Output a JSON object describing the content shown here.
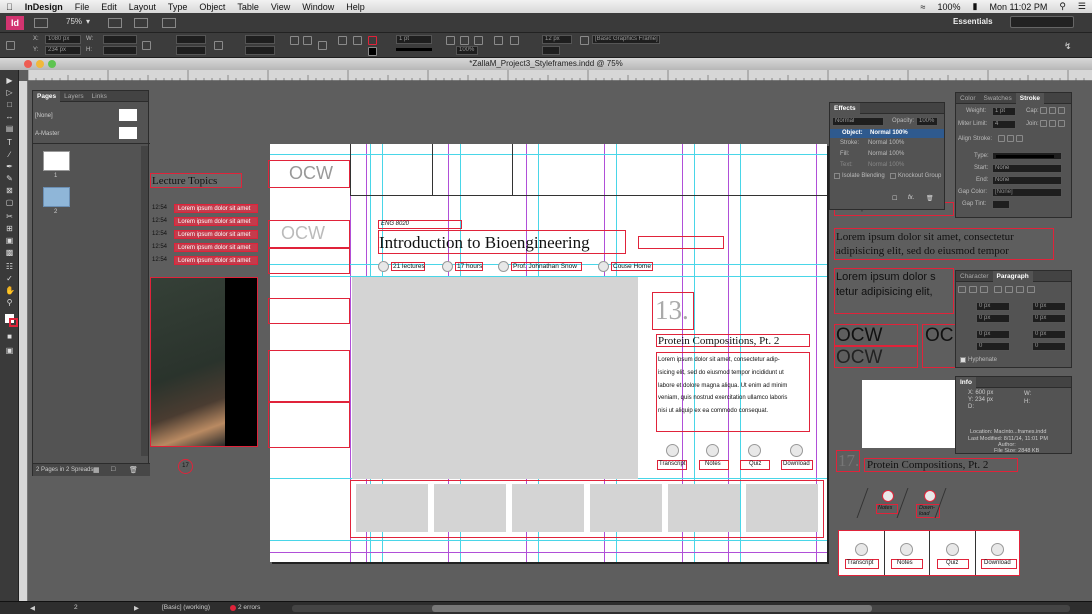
{
  "menubar": {
    "app": "InDesign",
    "items": [
      "File",
      "Edit",
      "Layout",
      "Type",
      "Object",
      "Table",
      "View",
      "Window",
      "Help"
    ],
    "battery": "100%",
    "clock": "Mon 11:02 PM"
  },
  "appbar": {
    "zoom": "75%",
    "workspace": "Essentials"
  },
  "control": {
    "x": "1080 px",
    "y": "234 px",
    "stroke_weight": "1 pt",
    "font_size": "12 px",
    "opacity_pct": "100%",
    "frame_style": "[Basic Graphics Frame]"
  },
  "document": {
    "title": "*ZallaM_Project3_Styleframes.indd @ 75%"
  },
  "pages_panel": {
    "tabs": [
      "Pages",
      "Layers",
      "Links"
    ],
    "masters": [
      "[None]",
      "A-Master"
    ],
    "page_numbers": [
      "1",
      "2"
    ],
    "footer": "2 Pages in 2 Spreads"
  },
  "pasteboard_left": {
    "heading": "Lecture Topics",
    "times": [
      "12:54",
      "12:54",
      "12:54",
      "12:54",
      "12:54"
    ],
    "lorem_items": [
      "Lorem ipsum dolor sit amet",
      "Lorem ipsum dolor sit amet",
      "Lorem ipsum dolor sit amet",
      "Lorem ipsum dolor sit amet",
      "Lorem ipsum dolor sit amet"
    ],
    "badge": "17"
  },
  "layout_page": {
    "logo1": "OCW",
    "logo2": "OCW",
    "course_code": "ENG 8020",
    "course_title": "Introduction to Bioengineering",
    "meta": [
      "21 lectures",
      "17 hours",
      "Prof. Johnathan Snow",
      "Couse Home"
    ],
    "lecture_number": "13.",
    "lecture_title": "Protein Compositions, Pt. 2",
    "body": [
      "Lorem ipsum dolor sit amet, consectetur adip-",
      "isicing elit, sed do eiusmod tempor incididunt ut",
      "labore et dolore magna aliqua. Ut enim ad minim",
      "veniam, quis nostrud exercitation ullamco laboris",
      "nisi ut aliquip ex ea commodo consequat."
    ],
    "actions": [
      "Transcript",
      "Notes",
      "Quiz",
      "Download"
    ]
  },
  "pasteboard_right": {
    "lorem_small": "mod tempor incididunt ut labore et d",
    "lorem_big1": [
      "Lorem ipsum dolor sit amet, consectetur",
      "adipisicing elit, sed do eiusmod tempor"
    ],
    "lorem_big2": [
      "Lorem ipsum dolor s",
      "tetur adipisicing elit,"
    ],
    "ocw": [
      "OCW",
      "OCW",
      "OC"
    ],
    "lecture_number": "17.",
    "lecture_title": "Protein Compositions, Pt. 2",
    "mini_actions": [
      "Notes",
      "Down-\nload"
    ],
    "actions": [
      "Transcript",
      "Notes",
      "Quiz",
      "Download"
    ]
  },
  "effects_panel": {
    "title": "Effects",
    "blend": "Normal",
    "opacity_label": "Opacity:",
    "opacity": "100%",
    "rows": [
      {
        "label": "Object:",
        "value": "Normal 100%"
      },
      {
        "label": "Stroke:",
        "value": "Normal 100%"
      },
      {
        "label": "Fill:",
        "value": "Normal 100%"
      },
      {
        "label": "Text:",
        "value": "Normal 100%"
      }
    ],
    "isolate": "Isolate Blending",
    "knockout": "Knockout Group"
  },
  "stroke_panel": {
    "tabs": [
      "Color",
      "Swatches",
      "Stroke"
    ],
    "weight_label": "Weight:",
    "weight": "1 pt",
    "cap_label": "Cap:",
    "miter_label": "Miter Limit:",
    "miter": "4",
    "join_label": "Join:",
    "align_label": "Align Stroke:",
    "type_label": "Type:",
    "start_label": "Start:",
    "start": "None",
    "end_label": "End:",
    "end": "None",
    "gapcolor_label": "Gap Color:",
    "gapcolor": "[None]",
    "gaptint_label": "Gap Tint:"
  },
  "paragraph_panel": {
    "tabs": [
      "Character",
      "Paragraph"
    ],
    "values": [
      "0 px",
      "0 px",
      "0 px",
      "0 px",
      "0 px",
      "0 px",
      "0",
      "0"
    ],
    "hyphenate": "Hyphenate"
  },
  "info_panel": {
    "title": "Info",
    "x": "X: 600 px",
    "y": "Y: 234 px",
    "d": "D:",
    "w": "W:",
    "h": "H:",
    "location": "Location: Macinto...frames.indd",
    "modified": "Last Modified: 8/11/14, 11:01 PM",
    "author": "Author:",
    "size": "File Size: 2848 KB"
  },
  "status": {
    "page": "2",
    "style": "[Basic] (working)",
    "errors": "2 errors"
  },
  "colors": {
    "frame_red": "#e0233a",
    "guide_cyan": "#49d6e8",
    "margin_purple": "#b04fd8"
  }
}
